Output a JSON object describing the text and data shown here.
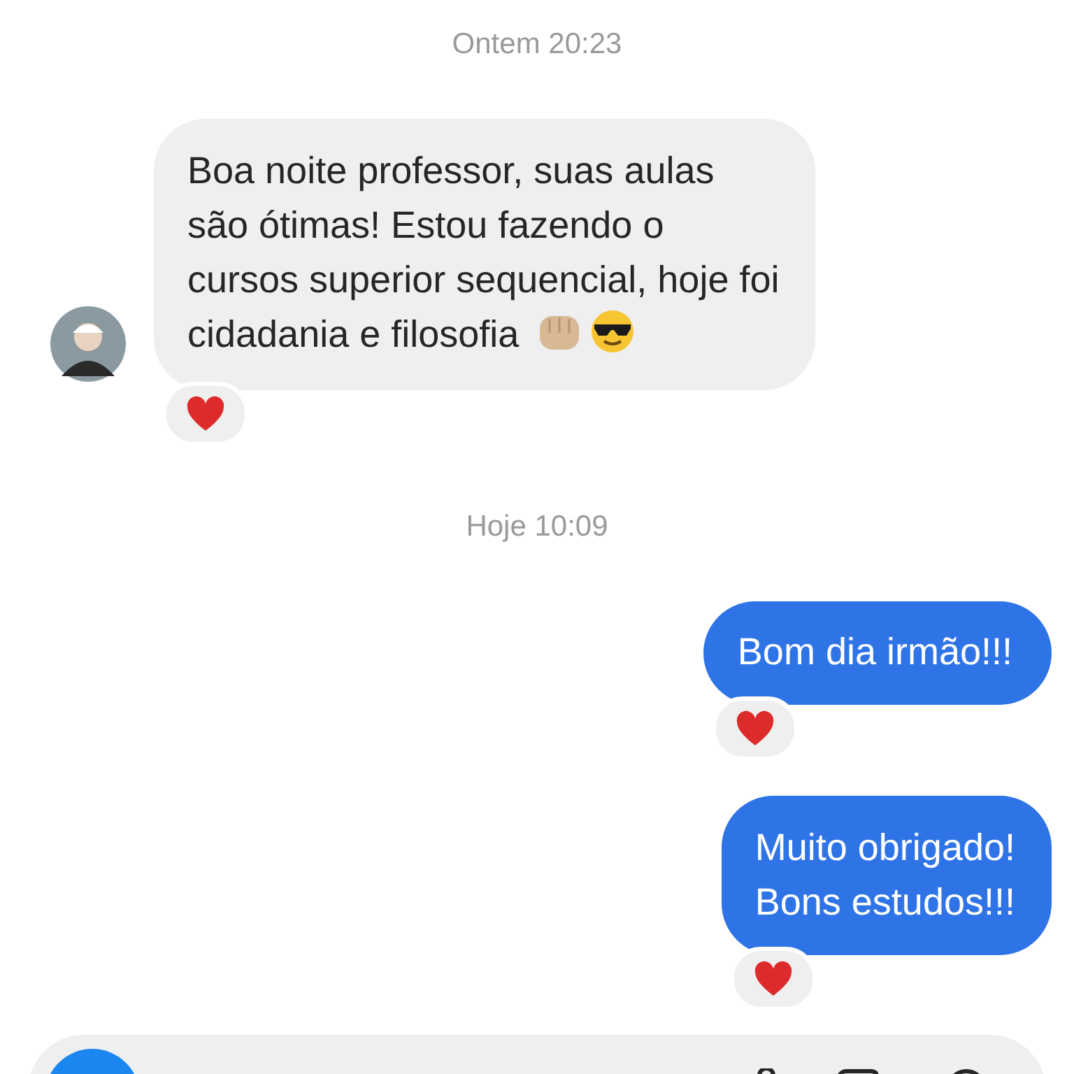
{
  "thread": [
    {
      "kind": "timestamp",
      "text": "Ontem 20:23"
    },
    {
      "kind": "incoming",
      "lines": [
        "Boa noite professor, suas aulas",
        "são ótimas! Estou fazendo o",
        "cursos superior sequencial, hoje foi",
        "cidadania e filosofia"
      ],
      "emojis": [
        {
          "kind": "fist"
        },
        {
          "kind": "sunglasses"
        }
      ],
      "reaction": {
        "kind": "heart"
      }
    },
    {
      "kind": "timestamp",
      "text": "Hoje 10:09"
    },
    {
      "kind": "outgoing",
      "lines": [
        "Bom dia irmão!!!"
      ],
      "reaction": {
        "kind": "heart"
      }
    },
    {
      "kind": "outgoing",
      "lines": [
        "Muito obrigado!",
        "Bons estudos!!!"
      ],
      "reaction": {
        "kind": "heart"
      }
    }
  ]
}
